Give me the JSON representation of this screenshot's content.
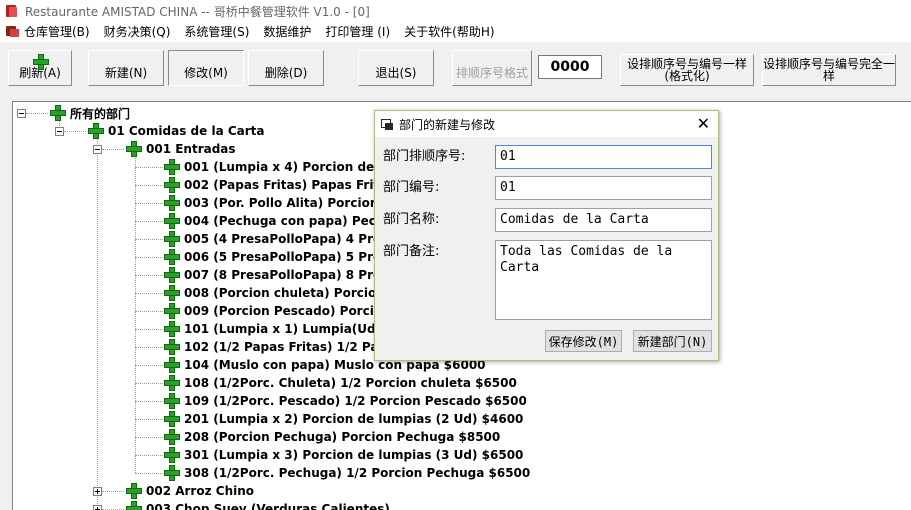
{
  "window": {
    "title": "Restaurante AMISTAD CHINA -- 哥桥中餐管理软件 V1.0 - [0]"
  },
  "menu": [
    "仓库管理(B)",
    "财务决策(Q)",
    "系统管理(S)",
    "数据维护",
    "打印管理 (I)",
    "关于软件(帮助H)"
  ],
  "toolbar": {
    "refresh": "刷新(A)",
    "new": "新建(N)",
    "modify": "修改(M)",
    "delete": "删除(D)",
    "exit": "退出(S)",
    "seq_format": "排顺序号格式",
    "seq_value": "0000",
    "set_same_format": "设排顺序号与编号一样(格式化)",
    "set_same_exact": "设排顺序号与编号完全一样"
  },
  "tree": {
    "root": "所有的部门",
    "category": "01  Comidas de la Carta",
    "group_open": "001  Entradas",
    "items": [
      "001  (Lumpia x 4)  Porcion de lum",
      "002  (Papas Fritas)  Papas Fritas",
      "003  (Por. Pollo Alita)  Porcion de p",
      "004  (Pechuga con papa)  Pechug",
      "005  (4 PresaPolloPapa)  4 Presa",
      "006  (5 PresaPolloPapa)  5 Presa",
      "007  (8 PresaPolloPapa)  8 Presa",
      "008  (Porcion chuleta)  Porcion ch",
      "009  (Porcion Pescado)  Porcion P",
      "101  (Lumpia x 1)  Lumpia(Ud.)    $",
      "102  (1/2 Papas Fritas)  1/2 Papas",
      "104  (Muslo con papa)  Muslo con papa    $6000",
      "108  (1/2Porc. Chuleta)  1/2 Porcion chuleta    $6500",
      "109  (1/2Porc. Pescado)  1/2 Porcion Pescado    $6500",
      "201  (Lumpia x 2)  Porcion de lumpias (2 Ud)    $4600",
      "208  (Porcion Pechuga)  Porcion Pechuga    $8500",
      "301  (Lumpia x 3)  Porcion de lumpias (3 Ud)    $6500",
      "308  (1/2Porc. Pechuga)  1/2 Porcion Pechuga    $6500"
    ],
    "group_closed_1": "002  Arroz Chino",
    "group_closed_2": "003  Chop Suey (Verduras Calientes)"
  },
  "dialog": {
    "title": "部门的新建与修改",
    "close": "✕",
    "seq_label": "部门排顺序号:",
    "seq_value": "01",
    "code_label": "部门编号:",
    "code_value": "01",
    "name_label": "部门名称:",
    "name_value": "Comidas de la Carta",
    "note_label": "部门备注:",
    "note_value": "Toda las Comidas de la Carta",
    "save_button": "保存修改(M)",
    "new_button": "新建部门(N)"
  }
}
